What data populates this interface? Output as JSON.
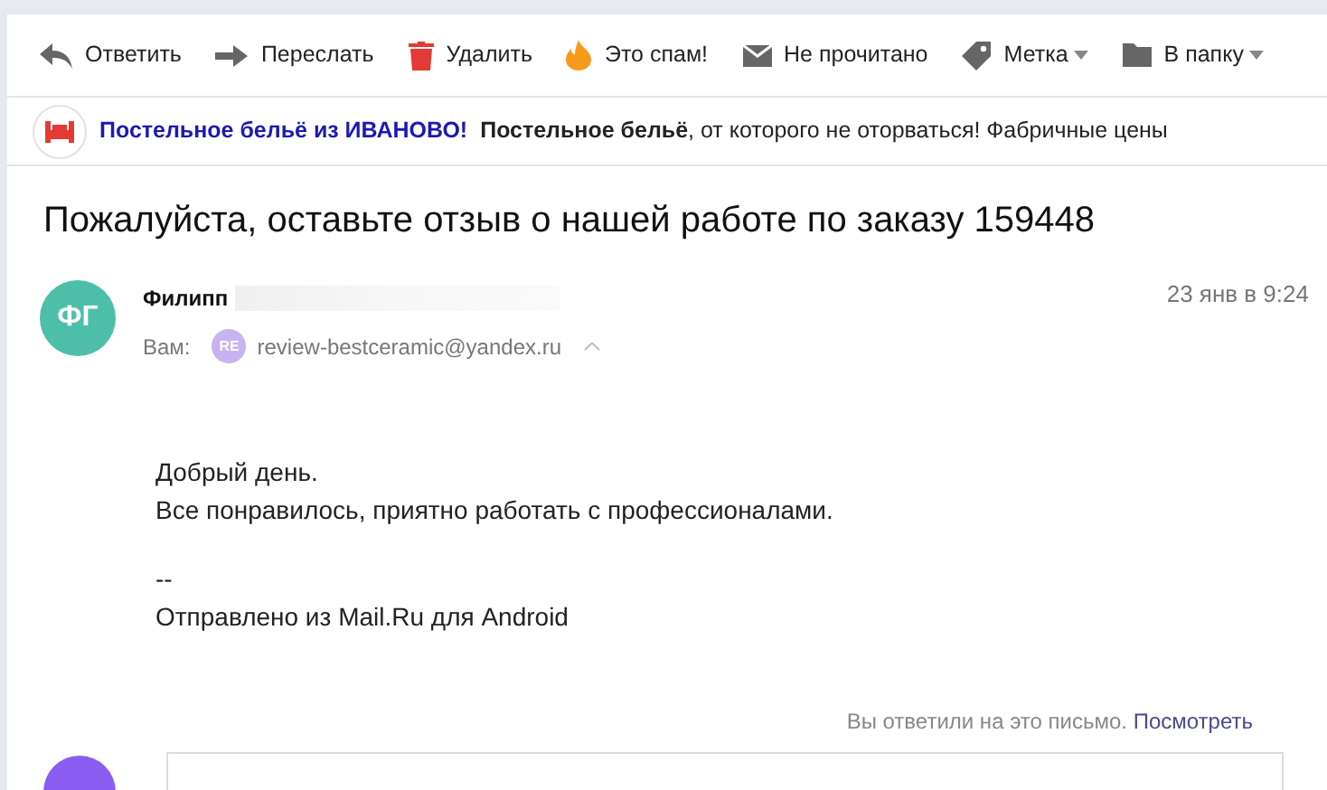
{
  "toolbar": [
    {
      "kind": "reply",
      "label": "Ответить",
      "dropdown": false
    },
    {
      "kind": "forward",
      "label": "Переслать",
      "dropdown": false
    },
    {
      "kind": "delete",
      "label": "Удалить",
      "dropdown": false
    },
    {
      "kind": "spam",
      "label": "Это спам!",
      "dropdown": false
    },
    {
      "kind": "unread",
      "label": "Не прочитано",
      "dropdown": false
    },
    {
      "kind": "label",
      "label": "Метка",
      "dropdown": true
    },
    {
      "kind": "folder",
      "label": "В папку",
      "dropdown": true
    }
  ],
  "ad": {
    "title": "Постельное бельё из ИВАНОВО!",
    "text": "**Постельное бельё**, от которого не оторваться! Фабричные цены"
  },
  "subject": "Пожалуйста, оставьте отзыв о нашей работе по заказу 159448",
  "message": {
    "avatar": "ФГ",
    "sender": "Филипп",
    "to_label": "Вам:",
    "recipient_avatar": "RE",
    "recipient": "review-bestceramic@yandex.ru",
    "date": "23 янв в 9:24",
    "body": [
      [
        "Добрый день.",
        "Все понравилось,  приятно работать с профессионалами."
      ],
      [
        "--",
        "Отправлено из Mail.Ru для Android"
      ]
    ]
  },
  "reply_note": {
    "text": "Вы ответили на это письмо.",
    "link": "Посмотреть"
  }
}
